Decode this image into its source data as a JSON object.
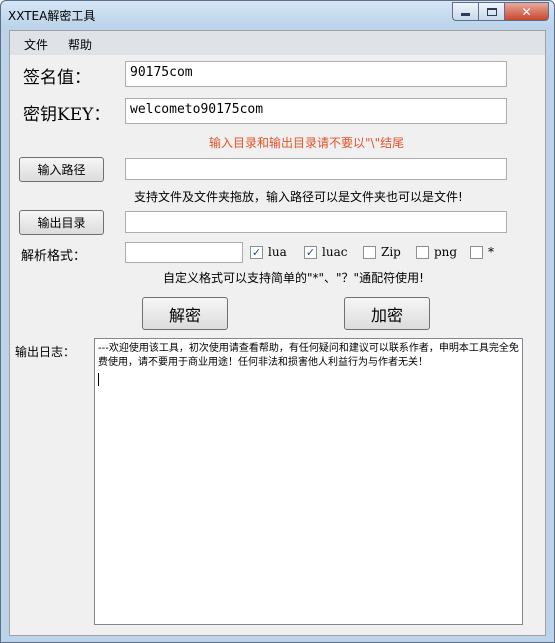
{
  "window": {
    "title": "XXTEA解密工具"
  },
  "title_controls": {
    "close_glyph": "✕"
  },
  "menu": {
    "items": [
      "文件",
      "帮助"
    ]
  },
  "form": {
    "sign_label": "签名值：",
    "sign_value": "90175com",
    "key_label": "密钥KEY：",
    "key_value": "welcometo90175com",
    "path_warning": "输入目录和输出目录请不要以\"\\\"结尾",
    "input_path_button": "输入路径",
    "input_path_value": "",
    "input_path_hint": "支持文件及文件夹拖放，输入路径可以是文件夹也可以是文件!",
    "output_dir_button": "输出目录",
    "output_dir_value": "",
    "format_label": "解析格式：",
    "format_value": "",
    "formats": [
      {
        "label": "lua",
        "checked": true
      },
      {
        "label": "luac",
        "checked": true
      },
      {
        "label": "Zip",
        "checked": false
      },
      {
        "label": "png",
        "checked": false
      },
      {
        "label": "*",
        "checked": false
      }
    ],
    "format_hint": "自定义格式可以支持简单的\"*\"、\"？\"通配符使用!",
    "decrypt_button": "解密",
    "encrypt_button": "加密"
  },
  "log": {
    "label": "输出日志：",
    "text": "---欢迎使用该工具，初次使用请查看帮助，有任何疑问和建议可以联系作者，申明本工具完全免费使用，请不要用于商业用途！任何非法和损害他人利益行为与作者无关！"
  },
  "colors": {
    "warning_text": "#e0542b",
    "title_bar": "#bcd3ea"
  }
}
